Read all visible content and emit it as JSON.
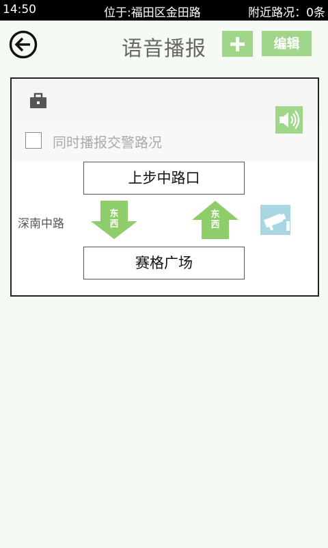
{
  "status_bar": {
    "time": "14:50",
    "location": "位于:福田区金田路",
    "nearby": "附近路况：0条"
  },
  "header": {
    "title": "语音播报",
    "back_icon": "back-arrow-icon",
    "add_icon": "plus-icon",
    "edit_label": "编辑"
  },
  "card": {
    "briefcase_icon": "briefcase-icon",
    "speaker_icon": "speaker-icon",
    "checkbox_label": "同时播报交警路况",
    "checkbox_checked": false,
    "from_station": "上步中路口",
    "to_station": "赛格广场",
    "road_name": "深南中路",
    "direction_down": [
      "东",
      "西"
    ],
    "direction_up": [
      "东",
      "西"
    ],
    "camera_icon": "camera-icon"
  },
  "colors": {
    "accent_green": "#9fd68a",
    "camera_blue": "#a8d6e2",
    "background": "#f5fbf3"
  }
}
